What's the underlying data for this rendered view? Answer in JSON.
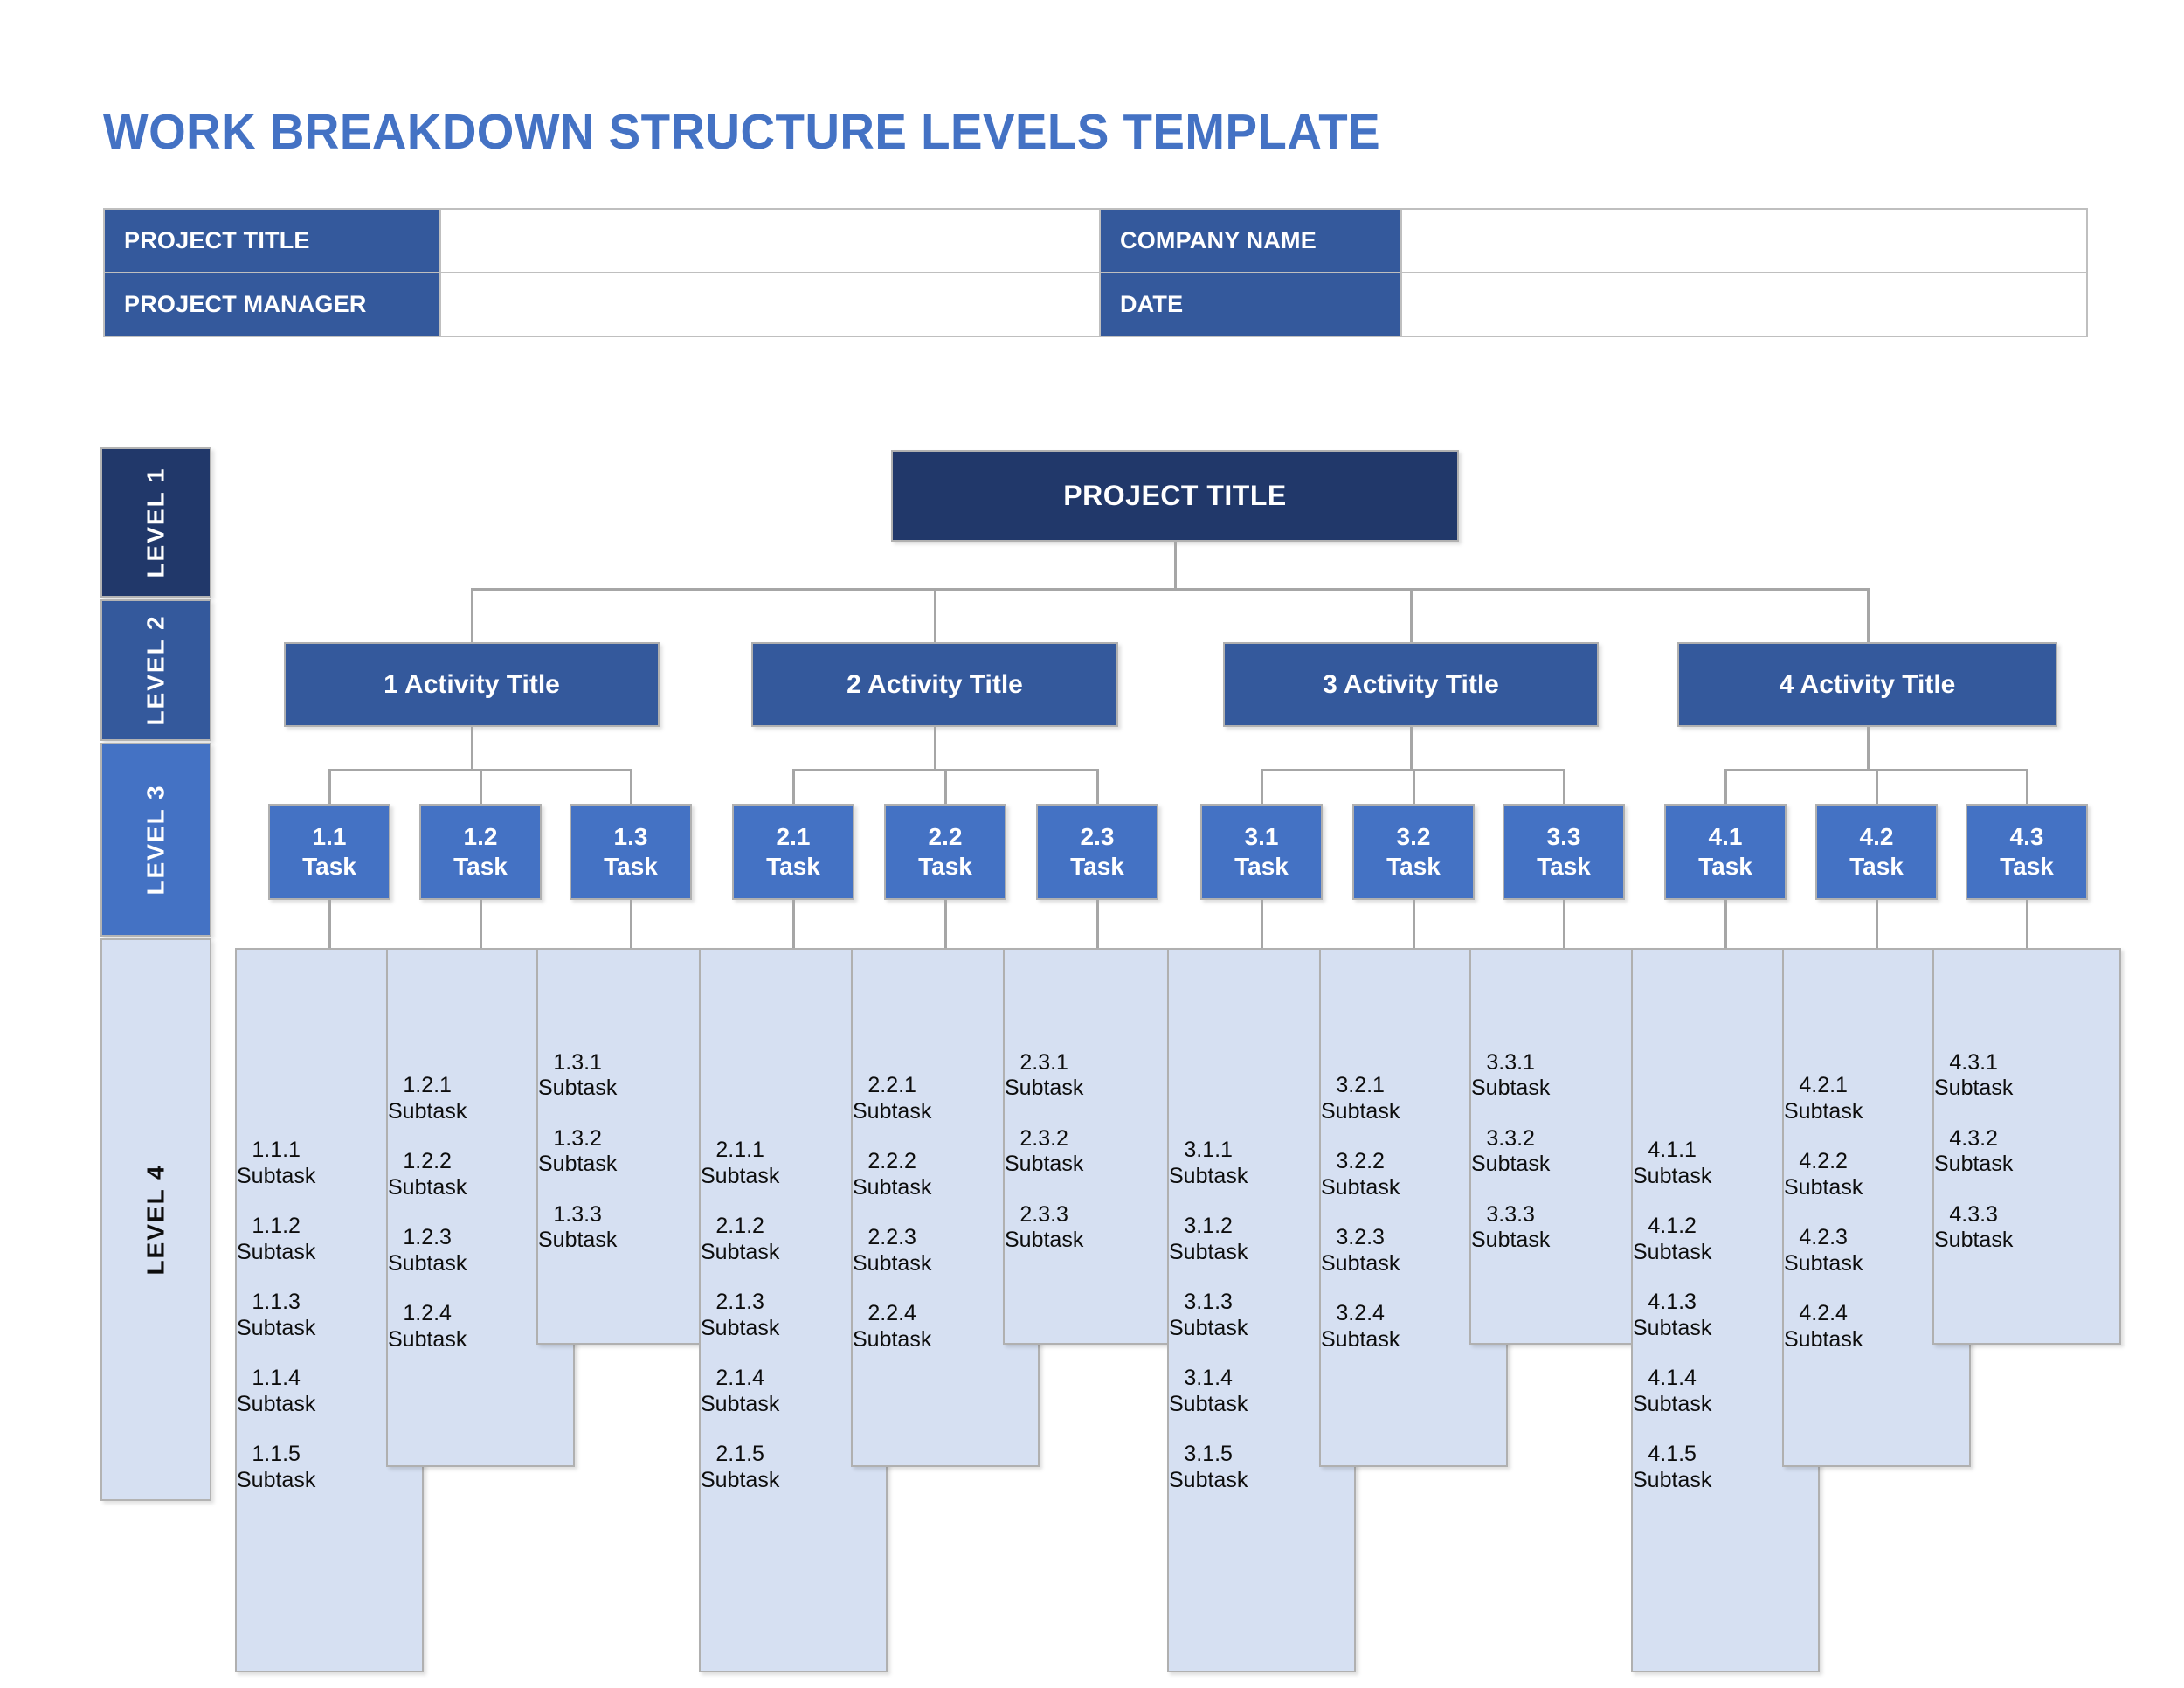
{
  "page_title": "WORK BREAKDOWN STRUCTURE LEVELS TEMPLATE",
  "info_table": {
    "project_title_label": "PROJECT TITLE",
    "project_title_value": "",
    "company_name_label": "COMPANY NAME",
    "company_name_value": "",
    "project_manager_label": "PROJECT MANAGER",
    "project_manager_value": "",
    "date_label": "DATE",
    "date_value": ""
  },
  "levels": [
    {
      "label": "LEVEL 1",
      "color": "#21386a"
    },
    {
      "label": "LEVEL 2",
      "color": "#34599c"
    },
    {
      "label": "LEVEL 3",
      "color": "#4472c4"
    },
    {
      "label": "LEVEL 4",
      "color": "#d6e0f2"
    }
  ],
  "colors": {
    "title": "#4472c4",
    "level1": "#21386a",
    "level2": "#34599c",
    "level3": "#4472c4",
    "level4": "#d6e0f2",
    "connector": "#a6a6a6",
    "border": "#b0b0b0"
  },
  "chart_data": {
    "type": "diagram",
    "root": "PROJECT TITLE",
    "activities": [
      {
        "label": "1 Activity Title",
        "tasks": [
          {
            "num": "1.1",
            "word": "Task",
            "subtasks": [
              "1.1.1",
              "1.1.2",
              "1.1.3",
              "1.1.4",
              "1.1.5"
            ],
            "sub_word": "Subtask"
          },
          {
            "num": "1.2",
            "word": "Task",
            "subtasks": [
              "1.2.1",
              "1.2.2",
              "1.2.3",
              "1.2.4"
            ],
            "sub_word": "Subtask"
          },
          {
            "num": "1.3",
            "word": "Task",
            "subtasks": [
              "1.3.1",
              "1.3.2",
              "1.3.3"
            ],
            "sub_word": "Subtask"
          }
        ]
      },
      {
        "label": "2 Activity Title",
        "tasks": [
          {
            "num": "2.1",
            "word": "Task",
            "subtasks": [
              "2.1.1",
              "2.1.2",
              "2.1.3",
              "2.1.4",
              "2.1.5"
            ],
            "sub_word": "Subtask"
          },
          {
            "num": "2.2",
            "word": "Task",
            "subtasks": [
              "2.2.1",
              "2.2.2",
              "2.2.3",
              "2.2.4"
            ],
            "sub_word": "Subtask"
          },
          {
            "num": "2.3",
            "word": "Task",
            "subtasks": [
              "2.3.1",
              "2.3.2",
              "2.3.3"
            ],
            "sub_word": "Subtask"
          }
        ]
      },
      {
        "label": "3 Activity Title",
        "tasks": [
          {
            "num": "3.1",
            "word": "Task",
            "subtasks": [
              "3.1.1",
              "3.1.2",
              "3.1.3",
              "3.1.4",
              "3.1.5"
            ],
            "sub_word": "Subtask"
          },
          {
            "num": "3.2",
            "word": "Task",
            "subtasks": [
              "3.2.1",
              "3.2.2",
              "3.2.3",
              "3.2.4"
            ],
            "sub_word": "Subtask"
          },
          {
            "num": "3.3",
            "word": "Task",
            "subtasks": [
              "3.3.1",
              "3.3.2",
              "3.3.3"
            ],
            "sub_word": "Subtask"
          }
        ]
      },
      {
        "label": "4 Activity Title",
        "tasks": [
          {
            "num": "4.1",
            "word": "Task",
            "subtasks": [
              "4.1.1",
              "4.1.2",
              "4.1.3",
              "4.1.4",
              "4.1.5"
            ],
            "sub_word": "Subtask"
          },
          {
            "num": "4.2",
            "word": "Task",
            "subtasks": [
              "4.2.1",
              "4.2.2",
              "4.2.3",
              "4.2.4"
            ],
            "sub_word": "Subtask"
          },
          {
            "num": "4.3",
            "word": "Task",
            "subtasks": [
              "4.3.1",
              "4.3.2",
              "4.3.3"
            ],
            "sub_word": "Subtask"
          }
        ]
      }
    ]
  }
}
